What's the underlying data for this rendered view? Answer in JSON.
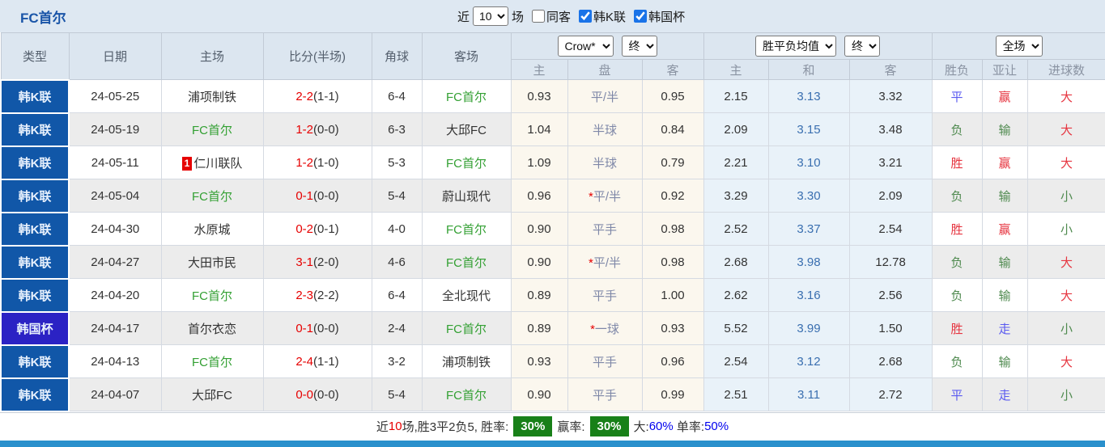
{
  "page": {
    "title": "FC首尔"
  },
  "colors": {
    "league_bg": "#1157a8",
    "cup_bg": "#2b22c4",
    "accent_checkbox": "#1a73e8",
    "win_red": "#e63540",
    "lose_green": "#4f8a4f",
    "draw_blue": "#5a5af0",
    "team_green": "#33a033",
    "score_red": "#e60000",
    "badge_green": "#188018",
    "percent_blue": "#0000ee",
    "bottom_bar": "#2a90cc"
  },
  "controls": {
    "near_label": "近",
    "games_value": "10",
    "games_label": "场",
    "checkboxes": [
      {
        "label": "同客",
        "checked": false
      },
      {
        "label": "韩K联",
        "checked": true
      },
      {
        "label": "韩国杯",
        "checked": true
      }
    ]
  },
  "header": {
    "cols": [
      "类型",
      "日期",
      "主场",
      "比分(半场)",
      "角球",
      "客场"
    ],
    "dropdowns": {
      "company": "Crow*",
      "time1": "终",
      "europe": "胜平负均值",
      "time2": "终",
      "scope": "全场"
    },
    "sub": [
      "主",
      "盘",
      "客",
      "主",
      "和",
      "客",
      "胜负",
      "亚让",
      "进球数"
    ]
  },
  "rows": [
    {
      "type": "韩K联",
      "cup": false,
      "date": "24-05-25",
      "home": "浦项制铁",
      "home_green": false,
      "home_badge": null,
      "score": "2-2",
      "half": "(1-1)",
      "corners": "6-4",
      "away": "FC首尔",
      "away_green": true,
      "asian_home": "0.93",
      "handicap": "平/半",
      "handicap_star": false,
      "asian_away": "0.95",
      "euro_home": "2.15",
      "euro_draw": "3.13",
      "euro_away": "3.32",
      "wdl": "平",
      "wdl_color": "blue",
      "handicap_result": "赢",
      "hc_color": "red",
      "overunder": "大",
      "ou_color": "red"
    },
    {
      "type": "韩K联",
      "cup": false,
      "date": "24-05-19",
      "home": "FC首尔",
      "home_green": true,
      "home_badge": null,
      "score": "1-2",
      "half": "(0-0)",
      "corners": "6-3",
      "away": "大邱FC",
      "away_green": false,
      "asian_home": "1.04",
      "handicap": "半球",
      "handicap_star": false,
      "asian_away": "0.84",
      "euro_home": "2.09",
      "euro_draw": "3.15",
      "euro_away": "3.48",
      "wdl": "负",
      "wdl_color": "green",
      "handicap_result": "输",
      "hc_color": "green",
      "overunder": "大",
      "ou_color": "red"
    },
    {
      "type": "韩K联",
      "cup": false,
      "date": "24-05-11",
      "home": "仁川联队",
      "home_green": false,
      "home_badge": "1",
      "score": "1-2",
      "half": "(1-0)",
      "corners": "5-3",
      "away": "FC首尔",
      "away_green": true,
      "asian_home": "1.09",
      "handicap": "半球",
      "handicap_star": false,
      "asian_away": "0.79",
      "euro_home": "2.21",
      "euro_draw": "3.10",
      "euro_away": "3.21",
      "wdl": "胜",
      "wdl_color": "red",
      "handicap_result": "赢",
      "hc_color": "red",
      "overunder": "大",
      "ou_color": "red"
    },
    {
      "type": "韩K联",
      "cup": false,
      "date": "24-05-04",
      "home": "FC首尔",
      "home_green": true,
      "home_badge": null,
      "score": "0-1",
      "half": "(0-0)",
      "corners": "5-4",
      "away": "蔚山现代",
      "away_green": false,
      "asian_home": "0.96",
      "handicap": "平/半",
      "handicap_star": true,
      "asian_away": "0.92",
      "euro_home": "3.29",
      "euro_draw": "3.30",
      "euro_away": "2.09",
      "wdl": "负",
      "wdl_color": "green",
      "handicap_result": "输",
      "hc_color": "green",
      "overunder": "小",
      "ou_color": "green"
    },
    {
      "type": "韩K联",
      "cup": false,
      "date": "24-04-30",
      "home": "水原城",
      "home_green": false,
      "home_badge": null,
      "score": "0-2",
      "half": "(0-1)",
      "corners": "4-0",
      "away": "FC首尔",
      "away_green": true,
      "asian_home": "0.90",
      "handicap": "平手",
      "handicap_star": false,
      "asian_away": "0.98",
      "euro_home": "2.52",
      "euro_draw": "3.37",
      "euro_away": "2.54",
      "wdl": "胜",
      "wdl_color": "red",
      "handicap_result": "赢",
      "hc_color": "red",
      "overunder": "小",
      "ou_color": "green"
    },
    {
      "type": "韩K联",
      "cup": false,
      "date": "24-04-27",
      "home": "大田市民",
      "home_green": false,
      "home_badge": null,
      "score": "3-1",
      "half": "(2-0)",
      "corners": "4-6",
      "away": "FC首尔",
      "away_green": true,
      "asian_home": "0.90",
      "handicap": "平/半",
      "handicap_star": true,
      "asian_away": "0.98",
      "euro_home": "2.68",
      "euro_draw": "3.98",
      "euro_away": "12.78",
      "wdl": "负",
      "wdl_color": "green",
      "handicap_result": "输",
      "hc_color": "green",
      "overunder": "大",
      "ou_color": "red"
    },
    {
      "type": "韩K联",
      "cup": false,
      "date": "24-04-20",
      "home": "FC首尔",
      "home_green": true,
      "home_badge": null,
      "score": "2-3",
      "half": "(2-2)",
      "corners": "6-4",
      "away": "全北现代",
      "away_green": false,
      "asian_home": "0.89",
      "handicap": "平手",
      "handicap_star": false,
      "asian_away": "1.00",
      "euro_home": "2.62",
      "euro_draw": "3.16",
      "euro_away": "2.56",
      "wdl": "负",
      "wdl_color": "green",
      "handicap_result": "输",
      "hc_color": "green",
      "overunder": "大",
      "ou_color": "red"
    },
    {
      "type": "韩国杯",
      "cup": true,
      "date": "24-04-17",
      "home": "首尔衣恋",
      "home_green": false,
      "home_badge": null,
      "score": "0-1",
      "half": "(0-0)",
      "corners": "2-4",
      "away": "FC首尔",
      "away_green": true,
      "asian_home": "0.89",
      "handicap": "一球",
      "handicap_star": true,
      "asian_away": "0.93",
      "euro_home": "5.52",
      "euro_draw": "3.99",
      "euro_away": "1.50",
      "wdl": "胜",
      "wdl_color": "red",
      "handicap_result": "走",
      "hc_color": "blue",
      "overunder": "小",
      "ou_color": "green"
    },
    {
      "type": "韩K联",
      "cup": false,
      "date": "24-04-13",
      "home": "FC首尔",
      "home_green": true,
      "home_badge": null,
      "score": "2-4",
      "half": "(1-1)",
      "corners": "3-2",
      "away": "浦项制铁",
      "away_green": false,
      "asian_home": "0.93",
      "handicap": "平手",
      "handicap_star": false,
      "asian_away": "0.96",
      "euro_home": "2.54",
      "euro_draw": "3.12",
      "euro_away": "2.68",
      "wdl": "负",
      "wdl_color": "green",
      "handicap_result": "输",
      "hc_color": "green",
      "overunder": "大",
      "ou_color": "red"
    },
    {
      "type": "韩K联",
      "cup": false,
      "date": "24-04-07",
      "home": "大邱FC",
      "home_green": false,
      "home_badge": null,
      "score": "0-0",
      "half": "(0-0)",
      "corners": "5-4",
      "away": "FC首尔",
      "away_green": true,
      "asian_home": "0.90",
      "handicap": "平手",
      "handicap_star": false,
      "asian_away": "0.99",
      "euro_home": "2.51",
      "euro_draw": "3.11",
      "euro_away": "2.72",
      "wdl": "平",
      "wdl_color": "blue",
      "handicap_result": "走",
      "hc_color": "blue",
      "overunder": "小",
      "ou_color": "green"
    }
  ],
  "summary": {
    "parts": [
      {
        "text": "近",
        "style": "dark"
      },
      {
        "text": "10",
        "style": "red"
      },
      {
        "text": "场,胜3平2负5, 胜率:",
        "style": "dark"
      },
      {
        "text": "30%",
        "style": "badge"
      },
      {
        "text": "赢率:",
        "style": "dark"
      },
      {
        "text": "30%",
        "style": "badge"
      },
      {
        "text": "大:",
        "style": "dark"
      },
      {
        "text": "60%",
        "style": "blue"
      },
      {
        "text": " 单率:",
        "style": "dark"
      },
      {
        "text": "50%",
        "style": "blue"
      }
    ]
  }
}
